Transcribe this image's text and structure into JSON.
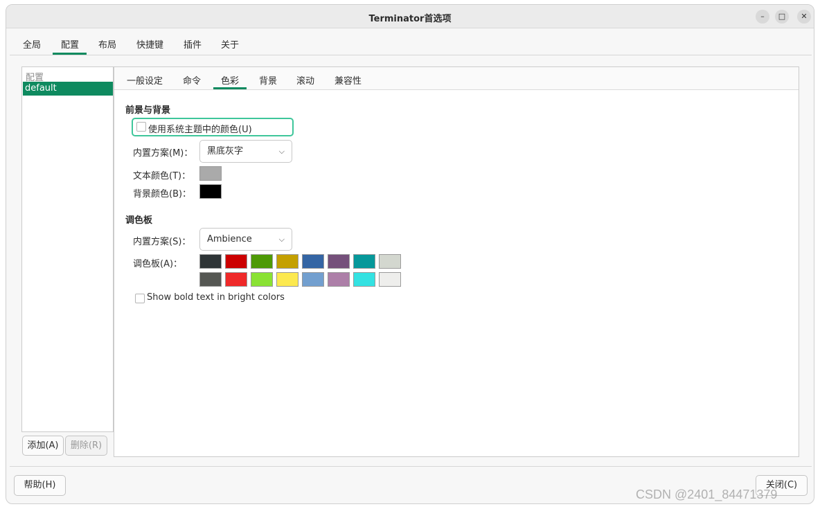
{
  "window": {
    "title": "Terminator首选项",
    "minimize_icon": "–",
    "maximize_icon": "□",
    "close_icon": "✕"
  },
  "top_tabs": [
    "全局",
    "配置",
    "布局",
    "快捷键",
    "插件",
    "关于"
  ],
  "active_top_tab": "配置",
  "profiles": {
    "header": "配置",
    "items": [
      "default"
    ],
    "selected": "default",
    "add_label": "添加(A)",
    "remove_label": "删除(R)"
  },
  "sub_tabs": [
    "一般设定",
    "命令",
    "色彩",
    "背景",
    "滚动",
    "兼容性"
  ],
  "active_sub_tab": "色彩",
  "colors_tab": {
    "fg_bg_title": "前景与背景",
    "use_system_theme_label": "使用系统主题中的颜色(U)",
    "use_system_theme_checked": false,
    "fg_scheme_label": "内置方案(M)：",
    "fg_scheme_value": "黑底灰字",
    "text_color_label": "文本颜色(T)：",
    "text_color": "#aaaaaa",
    "bg_color_label": "背景颜色(B)：",
    "bg_color": "#000000",
    "palette_title": "调色板",
    "palette_scheme_label": "内置方案(S)：",
    "palette_scheme_value": "Ambience",
    "palette_label": "调色板(A)：",
    "palette_row1": [
      "#2e3436",
      "#cc0000",
      "#4e9a06",
      "#c4a000",
      "#3465a4",
      "#75507b",
      "#06989a",
      "#d3d7cf"
    ],
    "palette_row2": [
      "#555753",
      "#ef2929",
      "#8ae234",
      "#fce94f",
      "#729fcf",
      "#ad7fa8",
      "#34e2e2",
      "#eeeeec"
    ],
    "bold_bright_label": "Show bold text in bright colors",
    "bold_bright_checked": false
  },
  "footer": {
    "help_label": "帮助(H)",
    "close_label": "关闭(C)"
  },
  "watermark": "CSDN @2401_84471379",
  "accent_color": "#0e8a5f"
}
